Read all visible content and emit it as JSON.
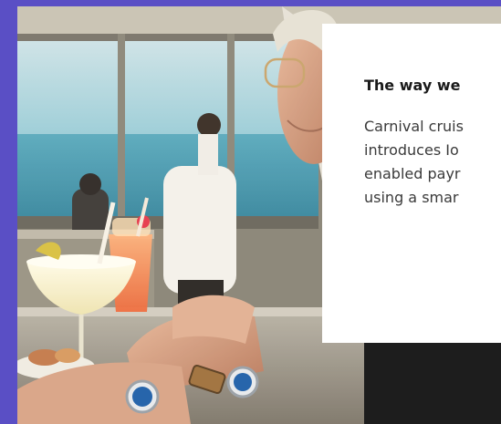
{
  "promo_card": {
    "heading": "The way we",
    "body_lines": [
      "Carnival cruis",
      "introduces Io",
      "enabled payr",
      "using a smar"
    ]
  },
  "photo": {
    "subject": "cruise-dining-scene"
  },
  "colors": {
    "frame_background": "#5b4fc6",
    "card_background": "#ffffff",
    "heading_text": "#1a1a1a",
    "body_text": "#3a3a3a"
  }
}
